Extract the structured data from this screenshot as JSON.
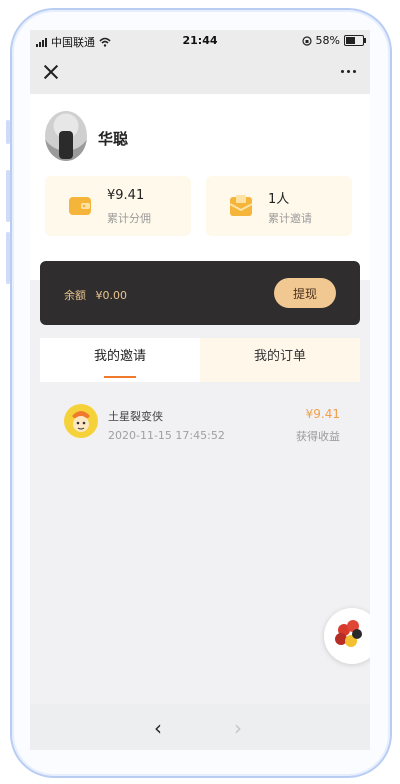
{
  "status_bar": {
    "carrier": "中国联通",
    "time": "21:44",
    "battery_text": "58%",
    "battery_level": 0.58
  },
  "navbar": {
    "close_icon": "close-icon",
    "more_icon": "more-icon"
  },
  "profile": {
    "name": "华聪"
  },
  "stats": [
    {
      "value": "¥9.41",
      "label": "累计分佣",
      "icon": "wallet-icon"
    },
    {
      "value": "1人",
      "label": "累计邀请",
      "icon": "envelope-icon"
    }
  ],
  "balance": {
    "label": "余额",
    "amount": "¥0.00",
    "withdraw_label": "提现"
  },
  "tabs": [
    {
      "label": "我的邀请",
      "active": true
    },
    {
      "label": "我的订单",
      "active": false
    }
  ],
  "invites": [
    {
      "name": "土星裂变侠",
      "time": "2020-11-15 17:45:52",
      "amount": "¥9.41",
      "amount_label": "获得收益"
    }
  ],
  "colors": {
    "accent": "#f07a2c",
    "gold": "#f2c892",
    "dark_card": "#2f2d2d",
    "amount": "#f0a04a"
  }
}
